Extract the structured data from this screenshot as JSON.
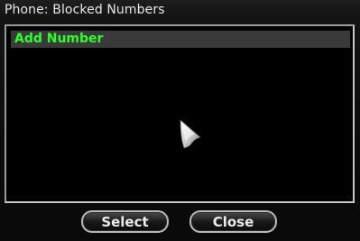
{
  "window": {
    "title": "Phone: Blocked Numbers"
  },
  "list": {
    "items": [
      {
        "label": "Add Number",
        "selected": true
      }
    ]
  },
  "buttons": {
    "select_label": "Select",
    "close_label": "Close"
  },
  "colors": {
    "item_text": "#2cff2c",
    "item_highlight": "#3a3a3a",
    "panel_border": "#9a9a9a",
    "background": "#000000"
  },
  "icons": {
    "pointer": "mouse-pointer-icon"
  }
}
